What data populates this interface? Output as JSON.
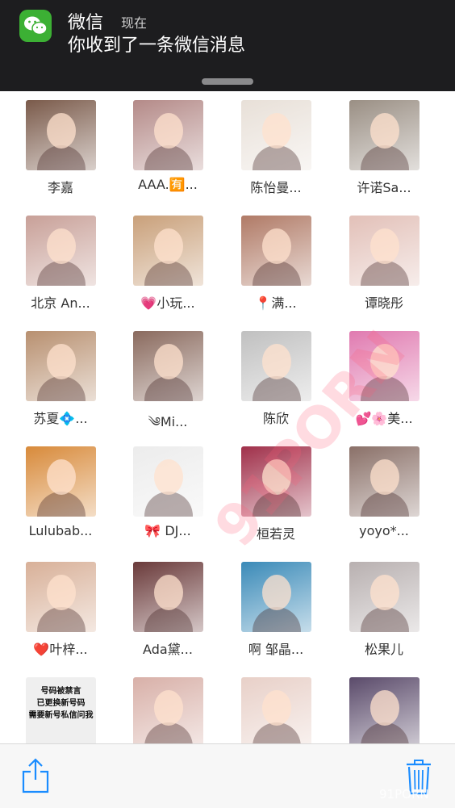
{
  "notification": {
    "app_name": "微信",
    "time": "现在",
    "message": "你收到了一条微信消息"
  },
  "contacts": [
    {
      "name": "李嘉",
      "color": "#7a5a4a"
    },
    {
      "name": "AAA.🈶...",
      "color": "#b48a88"
    },
    {
      "name": "陈怡曼...",
      "color": "#e8e0d8"
    },
    {
      "name": "许诺Sa...",
      "color": "#9a8f84"
    },
    {
      "name": "北京 An...",
      "color": "#c8a098"
    },
    {
      "name": "💗小玩...",
      "color": "#c9a07a"
    },
    {
      "name": "📍满...",
      "color": "#b07a66"
    },
    {
      "name": "谭晓彤",
      "color": "#e2c0b8"
    },
    {
      "name": "苏夏💠...",
      "color": "#b89070"
    },
    {
      "name": "༄Mi...",
      "color": "#8a6a5e"
    },
    {
      "name": "陈欣",
      "color": "#c0c0c0"
    },
    {
      "name": "💕🌸美...",
      "color": "#e07ab0"
    },
    {
      "name": "Lulubab...",
      "color": "#d88a3a"
    },
    {
      "name": "🎀 DJ...",
      "color": "#ececec"
    },
    {
      "name": "桓若灵",
      "color": "#a0304a"
    },
    {
      "name": "yoyo*...",
      "color": "#8a7068"
    },
    {
      "name": "❤️叶梓...",
      "color": "#d8b098"
    },
    {
      "name": "Ada黛...",
      "color": "#6a3a3a"
    },
    {
      "name": "啊 邹晶...",
      "color": "#3a8ab8"
    },
    {
      "name": "松果儿",
      "color": "#b8b0b0"
    },
    {
      "name": "",
      "color": "#efefef",
      "image_text": "号码被禁言\n已更换新号码\n需要新号私信问我"
    },
    {
      "name": "",
      "color": "#d8b0a8"
    },
    {
      "name": "",
      "color": "#e8d0c8"
    },
    {
      "name": "",
      "color": "#5a4a6a"
    }
  ],
  "toolbar": {
    "share_icon": "share-icon",
    "trash_icon": "trash-icon",
    "accent_color": "#1a8cff"
  },
  "watermark": {
    "diagonal": "91PORN",
    "corner": "91PORN"
  }
}
